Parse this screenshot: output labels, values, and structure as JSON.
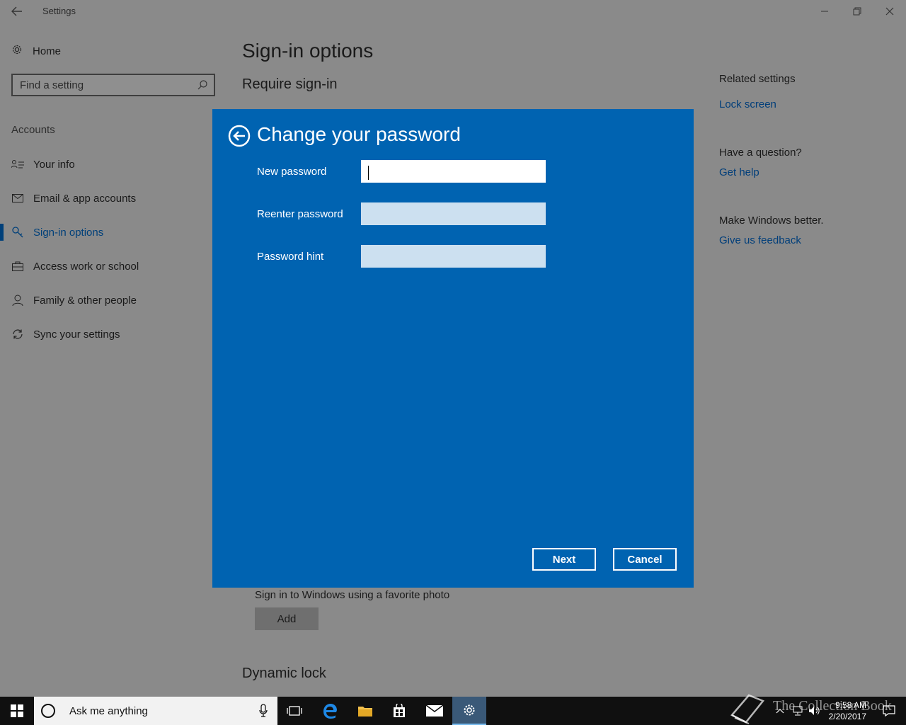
{
  "window": {
    "title": "Settings"
  },
  "sidebar": {
    "home_label": "Home",
    "search_placeholder": "Find a setting",
    "section": "Accounts",
    "items": [
      {
        "label": "Your info",
        "icon": "contact-card-icon",
        "active": false
      },
      {
        "label": "Email & app accounts",
        "icon": "mail-icon",
        "active": false
      },
      {
        "label": "Sign-in options",
        "icon": "key-icon",
        "active": true
      },
      {
        "label": "Access work or school",
        "icon": "briefcase-icon",
        "active": false
      },
      {
        "label": "Family & other people",
        "icon": "person-icon",
        "active": false
      },
      {
        "label": "Sync your settings",
        "icon": "sync-icon",
        "active": false
      }
    ]
  },
  "main": {
    "title": "Sign-in options",
    "require_heading": "Require sign-in",
    "picture_password_text": "Sign in to Windows using a favorite photo",
    "add_label": "Add",
    "dynamic_lock_heading": "Dynamic lock"
  },
  "related": {
    "heading": "Related settings",
    "lock_screen": "Lock screen",
    "question": "Have a question?",
    "get_help": "Get help",
    "better": "Make Windows better.",
    "feedback": "Give us feedback"
  },
  "dialog": {
    "title": "Change your password",
    "new_password_label": "New password",
    "new_password_value": "",
    "reenter_label": "Reenter password",
    "reenter_value": "",
    "hint_label": "Password hint",
    "hint_value": "",
    "next_label": "Next",
    "cancel_label": "Cancel",
    "bg_color": "#0063b1"
  },
  "taskbar": {
    "search_text": "Ask me anything",
    "time": "9:58 AM",
    "date": "2/20/2017",
    "apps": [
      "task-view-icon",
      "edge-icon",
      "file-explorer-icon",
      "store-icon",
      "mail-icon",
      "settings-icon"
    ]
  },
  "watermark": "The Collection Book"
}
